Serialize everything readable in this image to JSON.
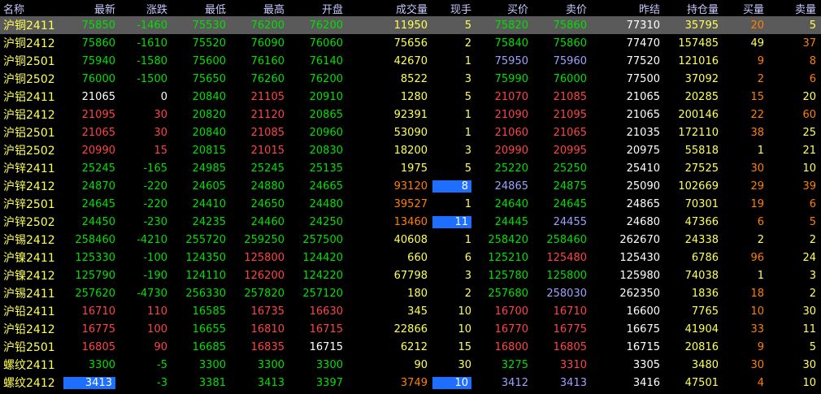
{
  "headers": [
    "名称",
    "最新",
    "涨跌",
    "最低",
    "最高",
    "开盘",
    "成交量",
    "现手",
    "买价",
    "卖价",
    "昨结",
    "持仓量",
    "买量",
    "卖量"
  ],
  "rows": [
    {
      "cells": [
        "沪铜2411",
        "75850",
        "-1460",
        "75530",
        "76200",
        "76200",
        "11950",
        "5",
        "75820",
        "75860",
        "77310",
        "35795",
        "20",
        "5"
      ],
      "cls": [
        "name",
        "g",
        "g",
        "g",
        "g",
        "g",
        "y",
        "y",
        "g",
        "g",
        "w",
        "y",
        "o",
        "y"
      ],
      "sel": true
    },
    {
      "cells": [
        "沪铜2412",
        "75860",
        "-1610",
        "75520",
        "76090",
        "76060",
        "75656",
        "2",
        "75840",
        "75860",
        "77470",
        "157485",
        "49",
        "37"
      ],
      "cls": [
        "name",
        "g",
        "g",
        "g",
        "g",
        "g",
        "y",
        "y",
        "g",
        "g",
        "w",
        "y",
        "y",
        "o"
      ]
    },
    {
      "cells": [
        "沪铜2501",
        "75940",
        "-1580",
        "75600",
        "76160",
        "76140",
        "42670",
        "1",
        "75950",
        "75960",
        "77520",
        "121016",
        "9",
        "8"
      ],
      "cls": [
        "name",
        "g",
        "g",
        "g",
        "g",
        "g",
        "y",
        "y",
        "c",
        "c",
        "w",
        "y",
        "o",
        "o"
      ]
    },
    {
      "cells": [
        "沪铜2502",
        "76000",
        "-1500",
        "75650",
        "76260",
        "76200",
        "8522",
        "3",
        "75990",
        "76000",
        "77500",
        "37092",
        "2",
        "6"
      ],
      "cls": [
        "name",
        "g",
        "g",
        "g",
        "g",
        "g",
        "y",
        "y",
        "g",
        "g",
        "w",
        "y",
        "o",
        "o"
      ]
    },
    {
      "cells": [
        "沪铝2411",
        "21065",
        "0",
        "20840",
        "21105",
        "20910",
        "1280",
        "5",
        "21070",
        "21085",
        "21065",
        "20285",
        "15",
        "20"
      ],
      "cls": [
        "name",
        "w",
        "w",
        "g",
        "r",
        "g",
        "y",
        "y",
        "r",
        "r",
        "w",
        "y",
        "o",
        "y"
      ]
    },
    {
      "cells": [
        "沪铝2412",
        "21095",
        "30",
        "20820",
        "21120",
        "20865",
        "92391",
        "1",
        "21090",
        "21095",
        "21065",
        "200146",
        "22",
        "60"
      ],
      "cls": [
        "name",
        "r",
        "r",
        "g",
        "r",
        "g",
        "y",
        "y",
        "r",
        "r",
        "w",
        "y",
        "o",
        "o"
      ]
    },
    {
      "cells": [
        "沪铝2501",
        "21065",
        "30",
        "20840",
        "21085",
        "20960",
        "53090",
        "1",
        "21060",
        "21065",
        "21035",
        "172110",
        "38",
        "25"
      ],
      "cls": [
        "name",
        "r",
        "r",
        "g",
        "r",
        "g",
        "y",
        "y",
        "r",
        "r",
        "w",
        "y",
        "o",
        "y"
      ]
    },
    {
      "cells": [
        "沪铝2502",
        "20990",
        "15",
        "20815",
        "21015",
        "20830",
        "18200",
        "3",
        "20990",
        "20995",
        "20975",
        "55818",
        "1",
        "21"
      ],
      "cls": [
        "name",
        "r",
        "r",
        "g",
        "r",
        "g",
        "y",
        "y",
        "r",
        "r",
        "w",
        "y",
        "y",
        "y"
      ]
    },
    {
      "cells": [
        "沪锌2411",
        "25245",
        "-165",
        "24985",
        "25245",
        "25135",
        "1975",
        "5",
        "25220",
        "25250",
        "25410",
        "27525",
        "30",
        "10"
      ],
      "cls": [
        "name",
        "g",
        "g",
        "g",
        "g",
        "g",
        "y",
        "y",
        "g",
        "g",
        "w",
        "y",
        "o",
        "y"
      ]
    },
    {
      "cells": [
        "沪锌2412",
        "24870",
        "-220",
        "24605",
        "24880",
        "24665",
        "93120",
        "8",
        "24865",
        "24875",
        "25090",
        "102669",
        "29",
        "39"
      ],
      "cls": [
        "name",
        "g",
        "g",
        "g",
        "g",
        "g",
        "o",
        "hl",
        "c",
        "g",
        "w",
        "y",
        "o",
        "o"
      ]
    },
    {
      "cells": [
        "沪锌2501",
        "24645",
        "-220",
        "24410",
        "24650",
        "24480",
        "39527",
        "1",
        "24640",
        "24645",
        "24865",
        "70301",
        "19",
        "6"
      ],
      "cls": [
        "name",
        "g",
        "g",
        "g",
        "g",
        "g",
        "o",
        "y",
        "g",
        "g",
        "w",
        "y",
        "o",
        "o"
      ]
    },
    {
      "cells": [
        "沪锌2502",
        "24450",
        "-230",
        "24235",
        "24460",
        "24250",
        "13460",
        "11",
        "24445",
        "24455",
        "24680",
        "47366",
        "6",
        "5"
      ],
      "cls": [
        "name",
        "g",
        "g",
        "g",
        "g",
        "g",
        "o",
        "hl",
        "g",
        "c",
        "w",
        "y",
        "o",
        "o"
      ]
    },
    {
      "cells": [
        "沪锡2412",
        "258460",
        "-4210",
        "255720",
        "259250",
        "257500",
        "40608",
        "1",
        "258420",
        "258460",
        "262670",
        "24338",
        "2",
        "2"
      ],
      "cls": [
        "name",
        "g",
        "g",
        "g",
        "g",
        "g",
        "y",
        "y",
        "g",
        "g",
        "w",
        "y",
        "y",
        "y"
      ]
    },
    {
      "cells": [
        "沪镍2411",
        "125330",
        "-100",
        "124350",
        "125800",
        "124420",
        "660",
        "6",
        "125210",
        "125480",
        "125430",
        "6786",
        "96",
        "24"
      ],
      "cls": [
        "name",
        "g",
        "g",
        "g",
        "r",
        "g",
        "y",
        "y",
        "g",
        "r",
        "w",
        "y",
        "o",
        "y"
      ]
    },
    {
      "cells": [
        "沪镍2412",
        "125790",
        "-190",
        "124110",
        "126200",
        "124220",
        "67798",
        "3",
        "125780",
        "125800",
        "125980",
        "74038",
        "1",
        "3"
      ],
      "cls": [
        "name",
        "g",
        "g",
        "g",
        "r",
        "g",
        "y",
        "y",
        "g",
        "g",
        "w",
        "y",
        "y",
        "y"
      ]
    },
    {
      "cells": [
        "沪锡2411",
        "257620",
        "-4730",
        "256330",
        "257820",
        "257120",
        "180",
        "2",
        "257680",
        "258030",
        "262350",
        "1836",
        "18",
        "2"
      ],
      "cls": [
        "name",
        "g",
        "g",
        "g",
        "g",
        "g",
        "y",
        "y",
        "g",
        "c",
        "w",
        "y",
        "o",
        "y"
      ]
    },
    {
      "cells": [
        "沪铅2411",
        "16710",
        "110",
        "16585",
        "16735",
        "16630",
        "345",
        "10",
        "16700",
        "16710",
        "16600",
        "7765",
        "10",
        "30"
      ],
      "cls": [
        "name",
        "r",
        "r",
        "g",
        "r",
        "r",
        "y",
        "y",
        "r",
        "r",
        "w",
        "y",
        "o",
        "y"
      ]
    },
    {
      "cells": [
        "沪铅2412",
        "16775",
        "100",
        "16655",
        "16810",
        "16715",
        "22866",
        "10",
        "16770",
        "16775",
        "16675",
        "41904",
        "33",
        "11"
      ],
      "cls": [
        "name",
        "r",
        "r",
        "g",
        "r",
        "r",
        "y",
        "y",
        "r",
        "r",
        "w",
        "y",
        "o",
        "y"
      ]
    },
    {
      "cells": [
        "沪铅2501",
        "16805",
        "90",
        "16685",
        "16835",
        "16715",
        "6212",
        "15",
        "16800",
        "16805",
        "16715",
        "20816",
        "9",
        "5"
      ],
      "cls": [
        "name",
        "r",
        "r",
        "g",
        "r",
        "w",
        "y",
        "y",
        "r",
        "r",
        "w",
        "y",
        "o",
        "y"
      ]
    },
    {
      "cells": [
        "螺纹2411",
        "3300",
        "-5",
        "3300",
        "3300",
        "3300",
        "90",
        "30",
        "3275",
        "3310",
        "3305",
        "3480",
        "30",
        "30"
      ],
      "cls": [
        "name",
        "g",
        "g",
        "g",
        "g",
        "g",
        "y",
        "y",
        "g",
        "r",
        "w",
        "y",
        "o",
        "y"
      ]
    },
    {
      "cells": [
        "螺纹2412",
        "3413",
        "-3",
        "3381",
        "3413",
        "3397",
        "3749",
        "10",
        "3412",
        "3413",
        "3416",
        "47501",
        "4",
        "10"
      ],
      "cls": [
        "name",
        "hl",
        "g",
        "g",
        "g",
        "g",
        "o",
        "hl",
        "c",
        "c",
        "w",
        "y",
        "o",
        "y"
      ]
    }
  ]
}
